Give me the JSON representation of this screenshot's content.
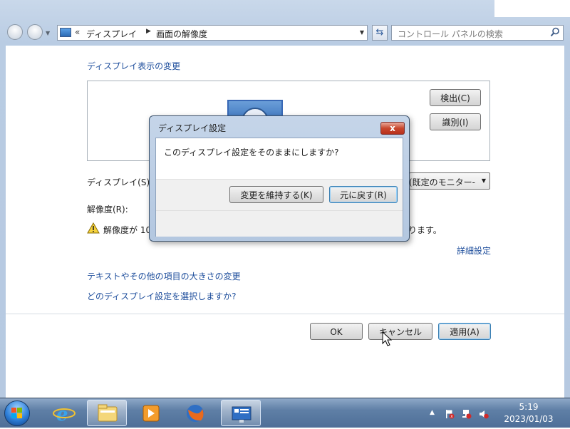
{
  "address": {
    "chevron": "«",
    "crumbs": [
      "ディスプレイ",
      "画面の解像度"
    ]
  },
  "search": {
    "placeholder": "コントロール パネルの検索"
  },
  "main": {
    "section_title": "ディスプレイ表示の変更",
    "detect_label": "検出(C)",
    "identify_label": "識別(I)",
    "display_label": "ディスプレイ(S):",
    "display_value": "の (既定のモニター-",
    "resolution_label": "解像度(R):",
    "warning_prefix": "解像度が 10",
    "warning_suffix": "ります。",
    "advanced_link": "詳細設定",
    "text_size_link": "テキストやその他の項目の大きさの変更",
    "which_settings_link": "どのディスプレイ設定を選択しますか?"
  },
  "footer": {
    "ok_label": "OK",
    "cancel_label": "キャンセル",
    "apply_label": "適用(A)"
  },
  "dialog": {
    "title": "ディスプレイ設定",
    "close_label": "x",
    "message": "このディスプレイ設定をそのままにしますか?",
    "keep_label": "変更を維持する(K)",
    "revert_label": "元に戻す(R)"
  },
  "taskbar": {
    "time": "5:19",
    "date": "2023/01/03",
    "items": [
      "internet-explorer",
      "explorer",
      "media-player",
      "firefox",
      "display-settings"
    ]
  },
  "colors": {
    "link": "#1e4e9c",
    "taskbar": "#5f7fa6",
    "dialog_close": "#c8472e"
  }
}
